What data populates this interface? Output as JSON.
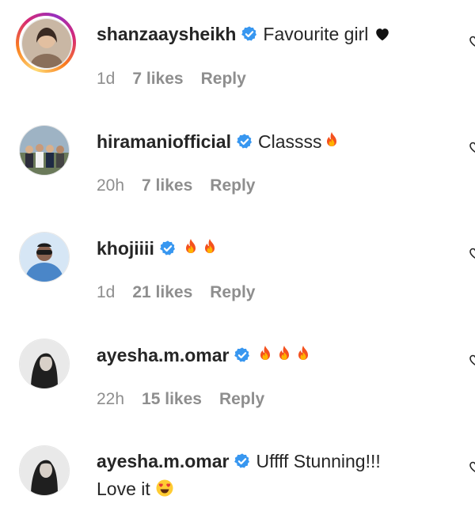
{
  "comments": [
    {
      "username": "shanzaaysheikh",
      "text": "Favourite girl",
      "emoji": "black-heart",
      "time": "1d",
      "likes": "7 likes",
      "reply": "Reply",
      "has_story": true
    },
    {
      "username": "hiramaniofficial",
      "text": "Classss",
      "emoji": "fire",
      "time": "20h",
      "likes": "7 likes",
      "reply": "Reply"
    },
    {
      "username": "khojiiii",
      "text": "",
      "emoji": "fire x2",
      "time": "1d",
      "likes": "21 likes",
      "reply": "Reply"
    },
    {
      "username": "ayesha.m.omar",
      "text": "",
      "emoji": "fire x3",
      "time": "22h",
      "likes": "15 likes",
      "reply": "Reply"
    },
    {
      "username": "ayesha.m.omar",
      "text": "Uffff Stunning!!!",
      "continuation": "Love it",
      "emoji": "heart-eyes"
    }
  ],
  "colors": {
    "verified": "#3897f0",
    "text": "#262626",
    "meta": "#8e8e8e",
    "story_ring": "#d62976"
  }
}
